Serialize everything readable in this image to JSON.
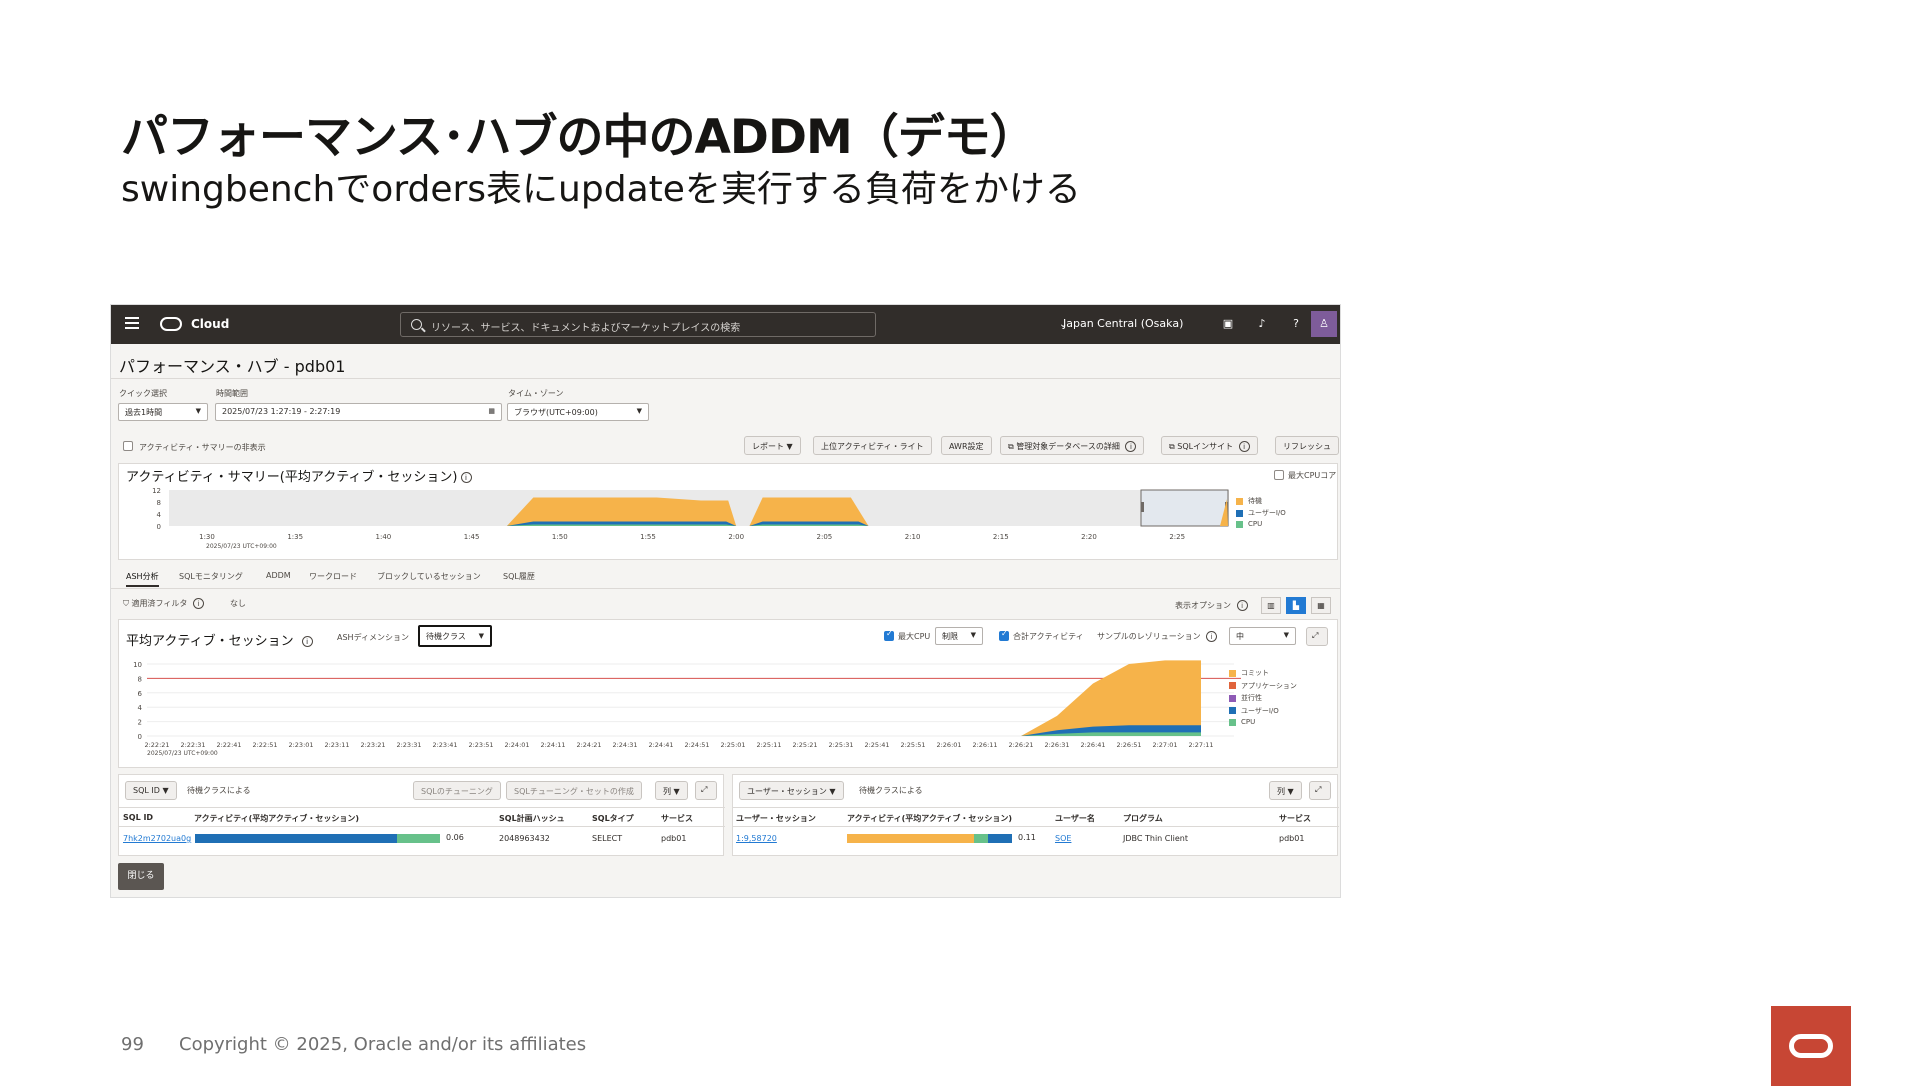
{
  "slide": {
    "title": "パフォーマンス･ハブの中のADDM（デモ）",
    "subtitle": "swingbenchでorders表にupdateを実行する負荷をかける",
    "page_number": "99",
    "copyright": "Copyright © 2025, Oracle and/or its affiliates"
  },
  "console": {
    "brand": "Cloud",
    "search_placeholder": "リソース、サービス、ドキュメントおよびマーケットプレイスの検索",
    "region": "Japan Central (Osaka)"
  },
  "page": {
    "title": "パフォーマンス・ハブ - pdb01",
    "quick_select_label": "クイック選択",
    "quick_select_value": "過去1時間",
    "time_range_label": "時間範囲",
    "time_range_value": "2025/07/23 1:27:19 - 2:27:19",
    "timezone_label": "タイム・ゾーン",
    "timezone_value": "ブラウザ(UTC+09:00)",
    "hide_summary_label": "アクティビティ・サマリーの非表示",
    "buttons": {
      "report": "レポート",
      "top_activity_lite": "上位アクティビティ・ライト",
      "awr_settings": "AWR設定",
      "managed_db_details": "管理対象データベースの詳細",
      "sql_insight": "SQLインサイト",
      "refresh": "リフレッシュ"
    },
    "close_button": "閉じる"
  },
  "summary_panel": {
    "title": "アクティビティ・サマリー(平均アクティブ・セッション)",
    "max_cpu_core_label": "最大CPUコア",
    "y_ticks": [
      "12",
      "8",
      "4",
      "0"
    ],
    "x_ticks": [
      "1:30",
      "1:35",
      "1:40",
      "1:45",
      "1:50",
      "1:55",
      "2:00",
      "2:05",
      "2:10",
      "2:15",
      "2:20",
      "2:25"
    ],
    "x_sub": "2025/07/23 UTC+09:00",
    "legend": [
      {
        "label": "待機",
        "color": "#f6b34a"
      },
      {
        "label": "ユーザーI/O",
        "color": "#1f6fb5"
      },
      {
        "label": "CPU",
        "color": "#67c18a"
      }
    ]
  },
  "tabs": [
    "ASH分析",
    "SQLモニタリング",
    "ADDM",
    "ワークロード",
    "ブロックしているセッション",
    "SQL履歴"
  ],
  "filter": {
    "label": "適用済フィルタ",
    "value": "なし",
    "display_options": "表示オプション"
  },
  "aas_panel": {
    "title": "平均アクティブ・セッション",
    "dimension_label": "ASHディメンション",
    "dimension_value": "待機クラス",
    "max_cpu_label": "最大CPU",
    "max_cpu_value": "制限",
    "total_activity_label": "合計アクティビティ",
    "resolution_label": "サンプルのレゾリューション",
    "resolution_value": "中",
    "y_ticks": [
      "10",
      "8",
      "6",
      "4",
      "2",
      "0"
    ],
    "x_ticks": [
      "2:22:21",
      "2:22:31",
      "2:22:41",
      "2:22:51",
      "2:23:01",
      "2:23:11",
      "2:23:21",
      "2:23:31",
      "2:23:41",
      "2:23:51",
      "2:24:01",
      "2:24:11",
      "2:24:21",
      "2:24:31",
      "2:24:41",
      "2:24:51",
      "2:25:01",
      "2:25:11",
      "2:25:21",
      "2:25:31",
      "2:25:41",
      "2:25:51",
      "2:26:01",
      "2:26:11",
      "2:26:21",
      "2:26:31",
      "2:26:41",
      "2:26:51",
      "2:27:01",
      "2:27:11"
    ],
    "x_sub": "2025/07/23 UTC+09:00",
    "legend": [
      {
        "label": "コミット",
        "color": "#f6b34a"
      },
      {
        "label": "アプリケーション",
        "color": "#e0643c"
      },
      {
        "label": "並行性",
        "color": "#8e5ab5"
      },
      {
        "label": "ユーザーI/O",
        "color": "#1f6fb5"
      },
      {
        "label": "CPU",
        "color": "#67c18a"
      }
    ]
  },
  "sql_table": {
    "dimension": "SQL ID",
    "group_label": "待機クラスによる",
    "sql_tuning_btn": "SQLのチューニング",
    "sql_tuning_set_btn": "SQLチューニング・セットの作成",
    "columns_btn": "列",
    "headers": [
      "SQL ID",
      "アクティビティ(平均アクティブ・セッション)",
      "SQL計画ハッシュ",
      "SQLタイプ",
      "サービス"
    ],
    "rows": [
      {
        "sql_id": "7hk2m2702ua0g",
        "value": "0.06",
        "plan_hash": "2048963432",
        "type": "SELECT",
        "service": "pdb01"
      }
    ]
  },
  "session_table": {
    "dimension": "ユーザー・セッション",
    "group_label": "待機クラスによる",
    "columns_btn": "列",
    "headers": [
      "ユーザー・セッション",
      "アクティビティ(平均アクティブ・セッション)",
      "ユーザー名",
      "プログラム",
      "サービス"
    ],
    "rows": [
      {
        "session": "1:9,58720",
        "value": "0.11",
        "user": "SOE",
        "program": "JDBC Thin Client",
        "service": "pdb01"
      }
    ]
  },
  "chart_data": [
    {
      "type": "area",
      "title": "アクティビティ・サマリー(平均アクティブ・セッション)",
      "x": [
        "1:30",
        "1:35",
        "1:40",
        "1:45",
        "1:50",
        "1:55",
        "2:00",
        "2:05",
        "2:10",
        "2:15",
        "2:20",
        "2:25"
      ],
      "ylim": [
        0,
        12
      ],
      "series": [
        {
          "name": "待機",
          "values": [
            0,
            0,
            0,
            0,
            8,
            8,
            8,
            8,
            0,
            0,
            0,
            0
          ]
        },
        {
          "name": "ユーザーI/O",
          "values": [
            0,
            0,
            0,
            0,
            1,
            1,
            1,
            1,
            0,
            0,
            0,
            0
          ]
        },
        {
          "name": "CPU",
          "values": [
            0,
            0,
            0,
            0,
            0.5,
            0.5,
            0.5,
            0.5,
            0,
            0,
            0,
            0
          ]
        }
      ]
    },
    {
      "type": "area",
      "title": "平均アクティブ・セッション",
      "x": [
        "2:26:21",
        "2:26:31",
        "2:26:41",
        "2:26:51",
        "2:27:01",
        "2:27:11"
      ],
      "ylim": [
        0,
        10
      ],
      "series": [
        {
          "name": "コミット",
          "values": [
            0,
            2,
            6,
            8.5,
            9,
            9
          ]
        },
        {
          "name": "ユーザーI/O",
          "values": [
            0,
            0.5,
            0.8,
            1,
            1,
            1
          ]
        },
        {
          "name": "CPU",
          "values": [
            0,
            0.3,
            0.5,
            0.5,
            0.5,
            0.5
          ]
        }
      ]
    }
  ]
}
